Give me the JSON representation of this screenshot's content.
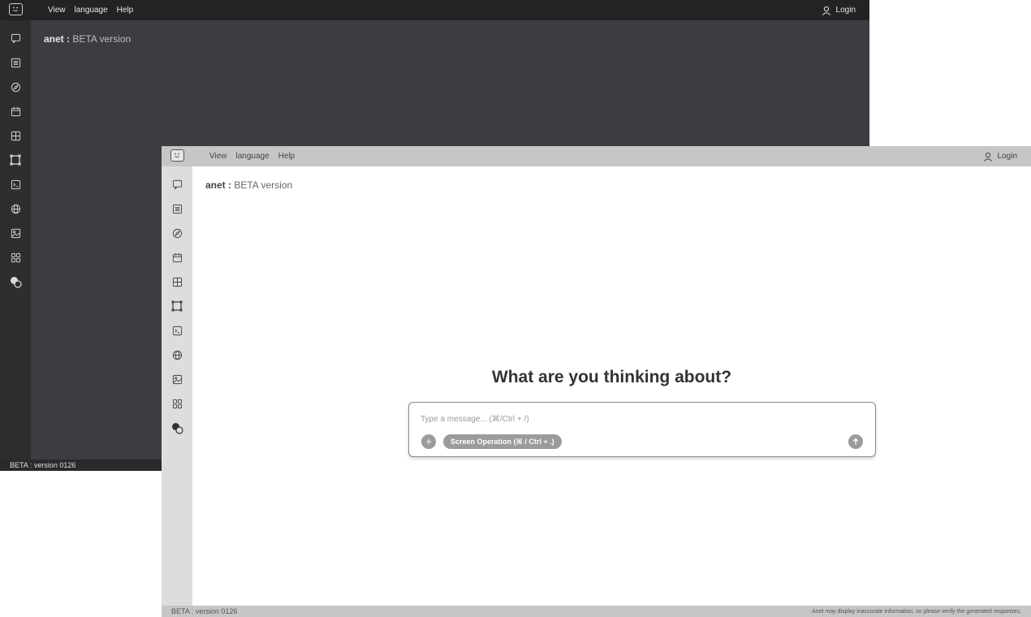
{
  "dark_window": {
    "menu": {
      "view": "View",
      "language": "language",
      "help": "Help"
    },
    "login": "Login",
    "brand": {
      "name": "anet :",
      "subtitle": "BETA version"
    },
    "footer": {
      "version": "BETA : version 0126"
    }
  },
  "light_window": {
    "menu": {
      "view": "View",
      "language": "language",
      "help": "Help"
    },
    "login": "Login",
    "brand": {
      "name": "anet :",
      "subtitle": "BETA version"
    },
    "hero_title": "What are you thinking about?",
    "composer": {
      "placeholder": "Type a message... (⌘/Ctrl + /)",
      "value": "",
      "plus_label": "+",
      "screen_operation_label": "Screen Operation (⌘ / Ctrl + .)"
    },
    "footer": {
      "version": "BETA : version 0126",
      "disclaimer": "Anet may display inaccurate information, so please verify the generated responses."
    }
  },
  "sidebar_icons": [
    "chat-icon",
    "list-icon",
    "compass-icon",
    "calendar-icon",
    "table-icon",
    "frame-icon",
    "terminal-icon",
    "globe-icon",
    "image-icon",
    "grid-icon",
    "shapes-icon"
  ],
  "colors": {
    "dark_bg": "#3c3d40",
    "dark_topbar": "#222325",
    "light_topbar": "#c6c6c6",
    "light_sidebar": "#dddddd",
    "accent_gray": "#9b9b9b"
  }
}
